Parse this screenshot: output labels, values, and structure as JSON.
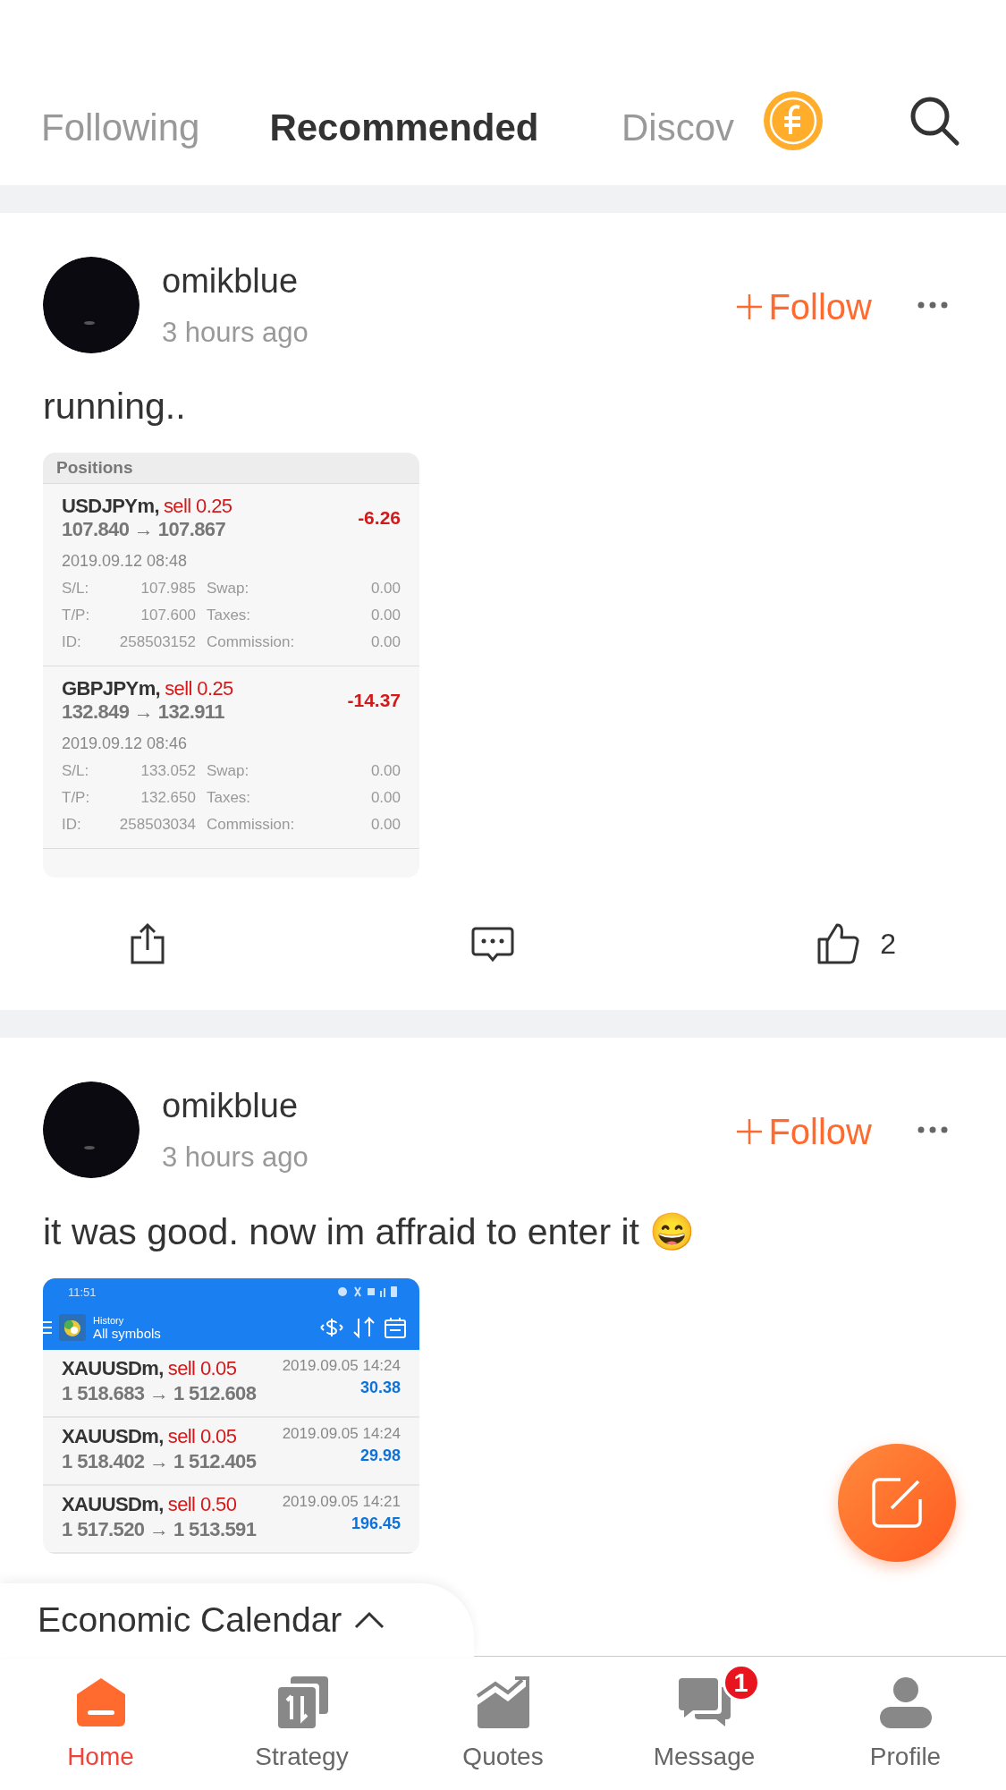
{
  "tabs": [
    {
      "label": "Following",
      "selected": false
    },
    {
      "label": "Recommended",
      "selected": true
    },
    {
      "label": "Discov",
      "selected": false
    }
  ],
  "posts": [
    {
      "user": "omikblue",
      "time": "3 hours ago",
      "follow_label": "Follow",
      "text": "running..",
      "attachment": {
        "kind": "positions",
        "title": "Positions",
        "positions": [
          {
            "symbol": "USDJPYm,",
            "side": "sell 0.25",
            "prices": "107.840 → 107.867",
            "profit": "-6.26",
            "time": "2019.09.12 08:48",
            "details": [
              {
                "label": "S/L:",
                "value": "107.985"
              },
              {
                "label": "Swap:",
                "value": "0.00"
              },
              {
                "label": "T/P:",
                "value": "107.600"
              },
              {
                "label": "Taxes:",
                "value": "0.00"
              },
              {
                "label": "ID:",
                "value": "258503152"
              },
              {
                "label": "Commission:",
                "value": "0.00"
              }
            ]
          },
          {
            "symbol": "GBPJPYm,",
            "side": "sell 0.25",
            "prices": "132.849 → 132.911",
            "profit": "-14.37",
            "time": "2019.09.12 08:46",
            "details": [
              {
                "label": "S/L:",
                "value": "133.052"
              },
              {
                "label": "Swap:",
                "value": "0.00"
              },
              {
                "label": "T/P:",
                "value": "132.650"
              },
              {
                "label": "Taxes:",
                "value": "0.00"
              },
              {
                "label": "ID:",
                "value": "258503034"
              },
              {
                "label": "Commission:",
                "value": "0.00"
              }
            ]
          }
        ]
      },
      "like_count": "2"
    },
    {
      "user": "omikblue",
      "time": "3 hours ago",
      "follow_label": "Follow",
      "text": "it was good. now im affraid to enter it 😄",
      "attachment": {
        "kind": "history",
        "status_time": "11:51",
        "title": "History",
        "subtitle": "All symbols",
        "deals": [
          {
            "symbol": "XAUUSDm,",
            "side": "sell 0.05",
            "prices": "1 518.683 → 1 512.608",
            "time": "2019.09.05 14:24",
            "profit": "30.38"
          },
          {
            "symbol": "XAUUSDm,",
            "side": "sell 0.05",
            "prices": "1 518.402 → 1 512.405",
            "time": "2019.09.05 14:24",
            "profit": "29.98"
          },
          {
            "symbol": "XAUUSDm,",
            "side": "sell 0.50",
            "prices": "1 517.520 → 1 513.591",
            "time": "2019.09.05 14:21",
            "profit": "196.45"
          }
        ]
      }
    }
  ],
  "calendar_tab": {
    "label": "Economic Calendar"
  },
  "nav": [
    {
      "kind": "home",
      "label": "Home",
      "selected": true
    },
    {
      "kind": "strategy",
      "label": "Strategy",
      "selected": false
    },
    {
      "kind": "quotes",
      "label": "Quotes",
      "selected": false
    },
    {
      "kind": "message",
      "label": "Message",
      "selected": false,
      "badge": "1"
    },
    {
      "kind": "profile",
      "label": "Profile",
      "selected": false
    }
  ]
}
